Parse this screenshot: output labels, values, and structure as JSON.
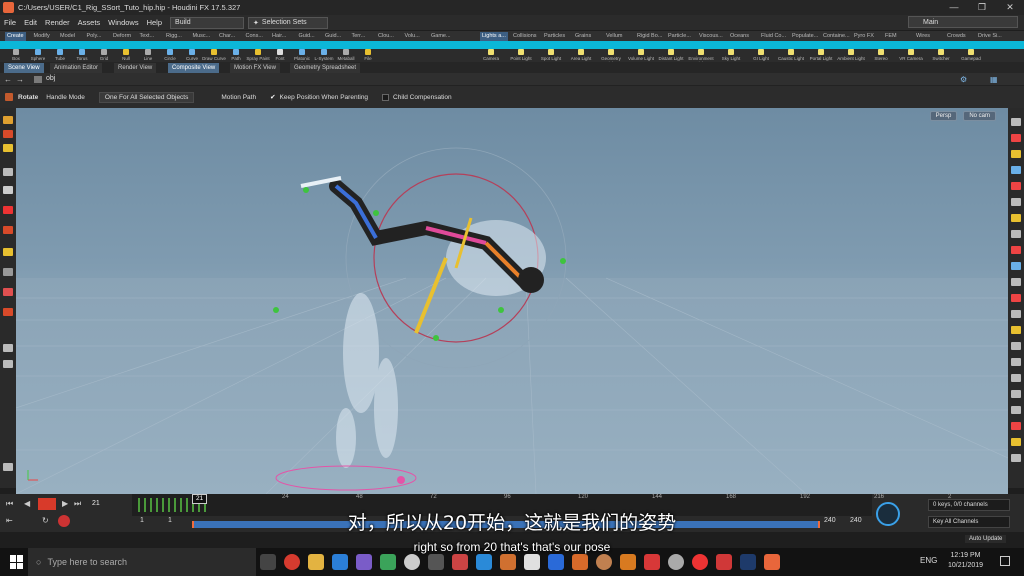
{
  "window": {
    "title": "C:/Users/USER/C1_Rig_SSort_Tuto_hip.hip - Houdini FX 17.5.327"
  },
  "menu": [
    "File",
    "Edit",
    "Render",
    "Assets",
    "Windows",
    "Help"
  ],
  "desktop": {
    "build": "Build",
    "selection_sets": "Selection Sets",
    "main": "Main"
  },
  "shelf_tabs_left": [
    "Create",
    "Modify",
    "Model",
    "Poly...",
    "Deform",
    "Text...",
    "Rigg...",
    "Musc...",
    "Char...",
    "Cons...",
    "Hair...",
    "Guid...",
    "Guid...",
    "Terr...",
    "Clou...",
    "Volu...",
    "Game..."
  ],
  "shelf_tabs_right": [
    "Lights a...",
    "Collisions",
    "Particles",
    "Grains",
    "Vellum",
    "Rigid Bo...",
    "Particle...",
    "Viscous...",
    "Oceans",
    "Fluid Co...",
    "Populate...",
    "Containe...",
    "Pyro FX",
    "FEM",
    "Wires",
    "Crowds",
    "Drive Si..."
  ],
  "tools_left": [
    "Box",
    "Sphere",
    "Tube",
    "Torus",
    "Grid",
    "Null",
    "Line",
    "Circle",
    "Curve",
    "Draw Curve",
    "Path",
    "Spray Paint",
    "Font",
    "Platonic Solids",
    "L-System",
    "Metaball",
    "File"
  ],
  "tools_right": [
    "Camera",
    "Point Light",
    "Spot Light",
    "Area Light",
    "Geometry Light",
    "Volume Light",
    "Distant Light",
    "Environment Light",
    "Sky Light",
    "GI Light",
    "Caustic Light",
    "Portal Light",
    "Ambient Light",
    "Stereo Camera",
    "VR Camera",
    "Switcher",
    "Gamepad Camera"
  ],
  "pane_tabs": [
    "Scene View",
    "Animation Editor",
    "Render View",
    "Composite View",
    "Motion FX View",
    "Geometry Spreadsheet"
  ],
  "path": "obj",
  "operation": {
    "tool": "Rotate",
    "handle_mode_label": "Handle Mode",
    "handle_mode_value": "One For All Selected Objects",
    "motion_path": "Motion Path",
    "keep_position": "Keep Position When Parenting",
    "child_comp": "Child Compensation"
  },
  "viewport": {
    "persp": "Persp",
    "cam": "No cam"
  },
  "timeline": {
    "current_frame": "21",
    "frame_marker": "21",
    "ticks": [
      "24",
      "48",
      "72",
      "96",
      "120",
      "144",
      "168",
      "192",
      "216",
      "2"
    ],
    "start": "1",
    "start2": "1",
    "end": "240",
    "end2": "240",
    "keys": "0 keys, 0/0 channels",
    "key_all": "Key All Channels",
    "auto_update": "Auto Update"
  },
  "subtitles": {
    "zh": "对，所以从20开始，这就是我们的姿势",
    "en": "right so from 20 that's that's our pose"
  },
  "taskbar": {
    "search_placeholder": "Type here to search",
    "lang": "ENG",
    "time": "12:19 PM",
    "date": "10/21/2019"
  },
  "colors": {
    "shelf_accent": "#0bb7d8",
    "range_bar": "#3a72b8",
    "viewport_bg": "#7f9bb0"
  }
}
